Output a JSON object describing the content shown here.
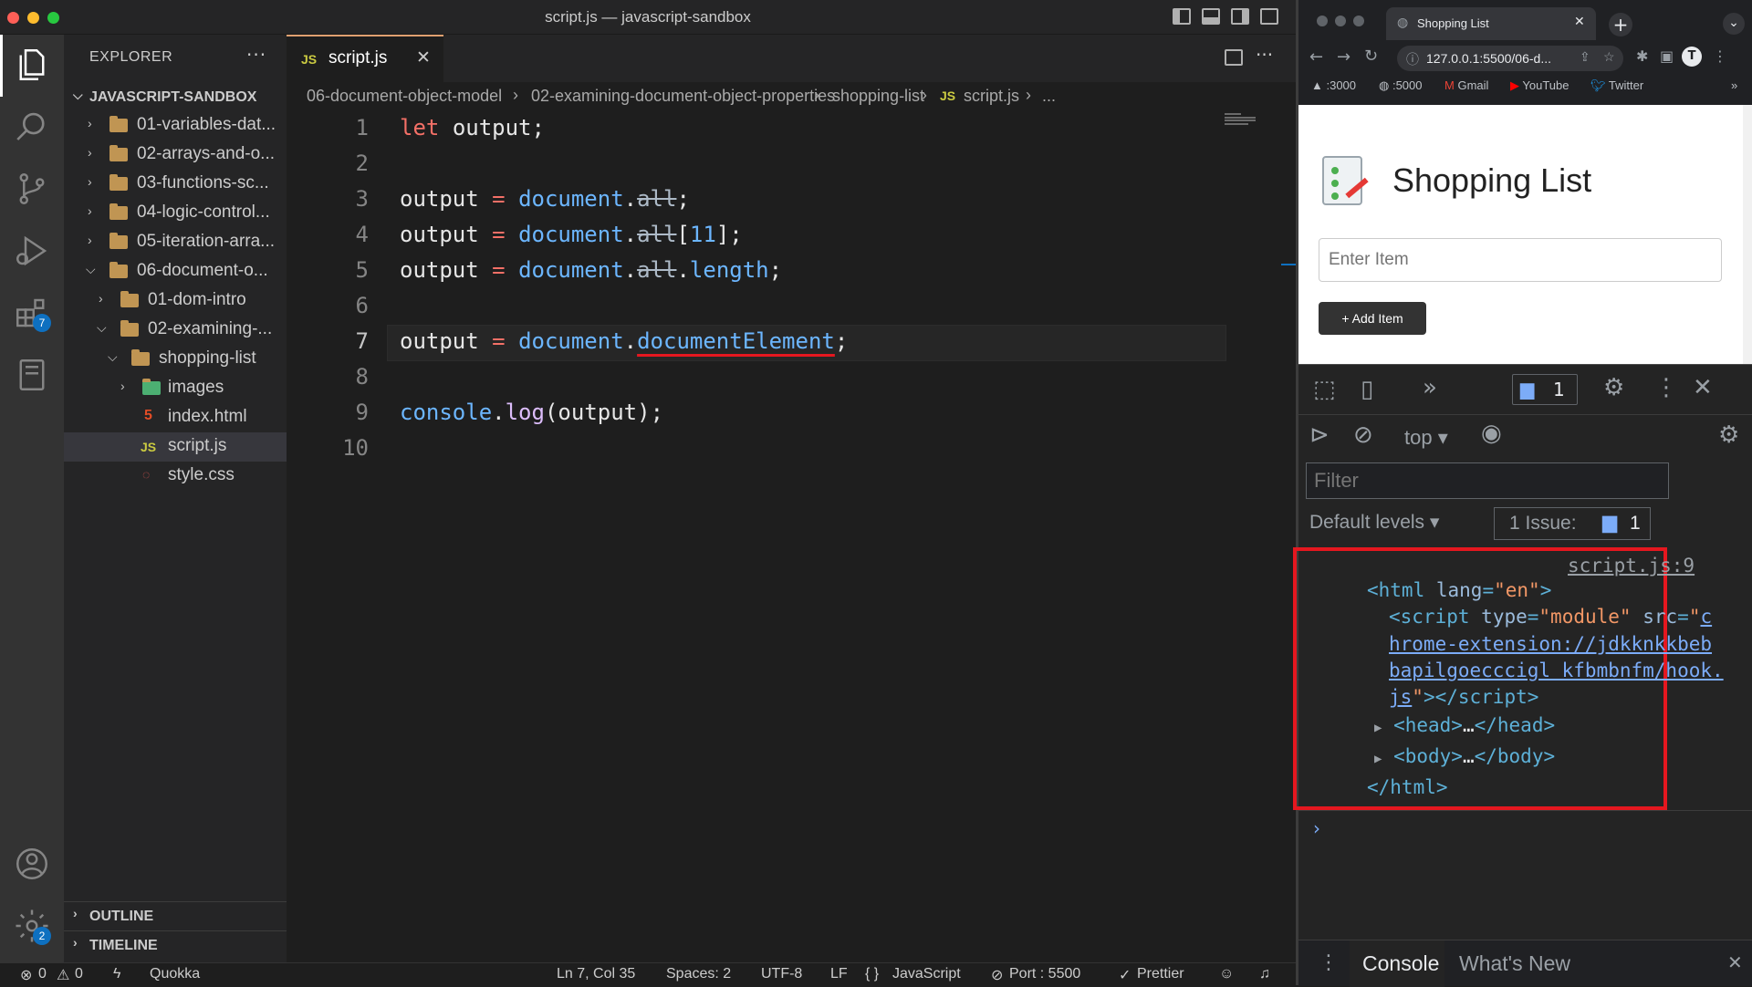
{
  "window": {
    "title": "script.js — javascript-sandbox"
  },
  "explorer": {
    "title": "EXPLORER",
    "more": "···",
    "root": "JAVASCRIPT-SANDBOX",
    "items": [
      {
        "label": "01-variables-dat...",
        "type": "folder"
      },
      {
        "label": "02-arrays-and-o...",
        "type": "folder"
      },
      {
        "label": "03-functions-sc...",
        "type": "folder"
      },
      {
        "label": "04-logic-control...",
        "type": "folder"
      },
      {
        "label": "05-iteration-arra...",
        "type": "folder"
      },
      {
        "label": "06-document-o...",
        "type": "folder"
      },
      {
        "label": "01-dom-intro",
        "type": "folder"
      },
      {
        "label": "02-examining-...",
        "type": "folder"
      },
      {
        "label": "shopping-list",
        "type": "folder"
      },
      {
        "label": "images",
        "type": "folder"
      },
      {
        "label": "index.html",
        "type": "html"
      },
      {
        "label": "script.js",
        "type": "js"
      },
      {
        "label": "style.css",
        "type": "css"
      }
    ],
    "outline": "OUTLINE",
    "timeline": "TIMELINE"
  },
  "activity": {
    "extensions_badge": "7",
    "settings_badge": "2"
  },
  "tab": {
    "label": "script.js",
    "badge": "JS"
  },
  "breadcrumb": {
    "parts": [
      "06-document-object-model",
      "02-examining-document-object-properties",
      "shopping-list",
      "script.js",
      "..."
    ],
    "sep": "›"
  },
  "editor": {
    "line_numbers": [
      "1",
      "2",
      "3",
      "4",
      "5",
      "6",
      "7",
      "8",
      "9",
      "10"
    ],
    "current_line": "7"
  },
  "status": {
    "errors": "0",
    "warnings": "0",
    "quokka": "Quokka",
    "position": "Ln 7, Col 35",
    "spaces": "Spaces: 2",
    "encoding": "UTF-8",
    "eol": "LF",
    "language": "JavaScript",
    "port": "Port : 5500",
    "prettier": "Prettier"
  },
  "browser": {
    "tab_title": "Shopping List",
    "url": "127.0.0.1:5500/06-d...",
    "bookmarks": [
      ":3000",
      ":5000",
      "Gmail",
      "YouTube",
      "Twitter"
    ],
    "page_title": "Shopping List",
    "input_placeholder": "Enter Item",
    "add_button": "+ Add Item"
  },
  "devtools": {
    "issues_count": "1",
    "context": "top",
    "filter_placeholder": "Filter",
    "levels": "Default levels",
    "issue_label": "1 Issue:",
    "issue_count": "1",
    "source_link": "script.js:9",
    "bottom_tabs": [
      "Console",
      "What's New"
    ]
  }
}
